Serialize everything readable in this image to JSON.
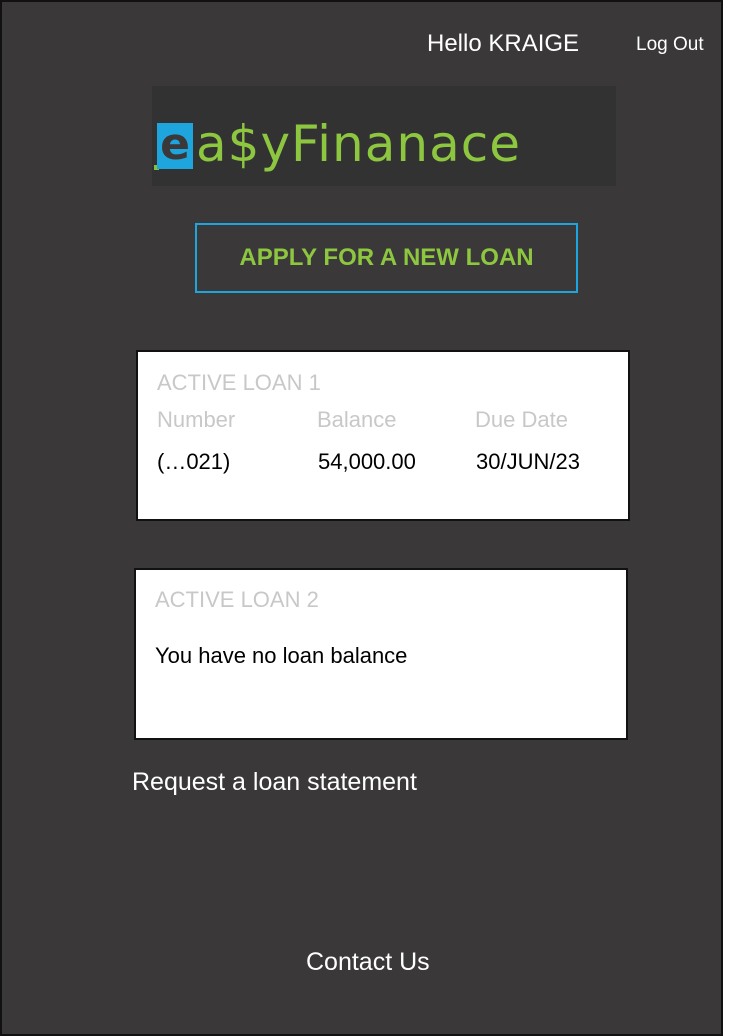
{
  "header": {
    "greeting": "Hello KRAIGE",
    "logout_label": "Log Out"
  },
  "logo": {
    "mark": "e",
    "text": "a$yFinanace",
    "accent_color": "#1ea5dd",
    "brand_color": "#8dc63f"
  },
  "apply_button": {
    "label": "APPLY FOR A NEW LOAN"
  },
  "loans": [
    {
      "title": "ACTIVE LOAN 1",
      "columns": [
        "Number",
        "Balance",
        "Due Date"
      ],
      "values": [
        "(…021)",
        "54,000.00",
        "30/JUN/23"
      ]
    },
    {
      "title": "ACTIVE LOAN 2",
      "message": "You have no loan balance"
    }
  ],
  "links": {
    "statement": "Request a loan statement",
    "contact": "Contact Us"
  },
  "colors": {
    "background": "#3a3839",
    "card": "#ffffff",
    "muted_text": "#c8c8c8"
  }
}
